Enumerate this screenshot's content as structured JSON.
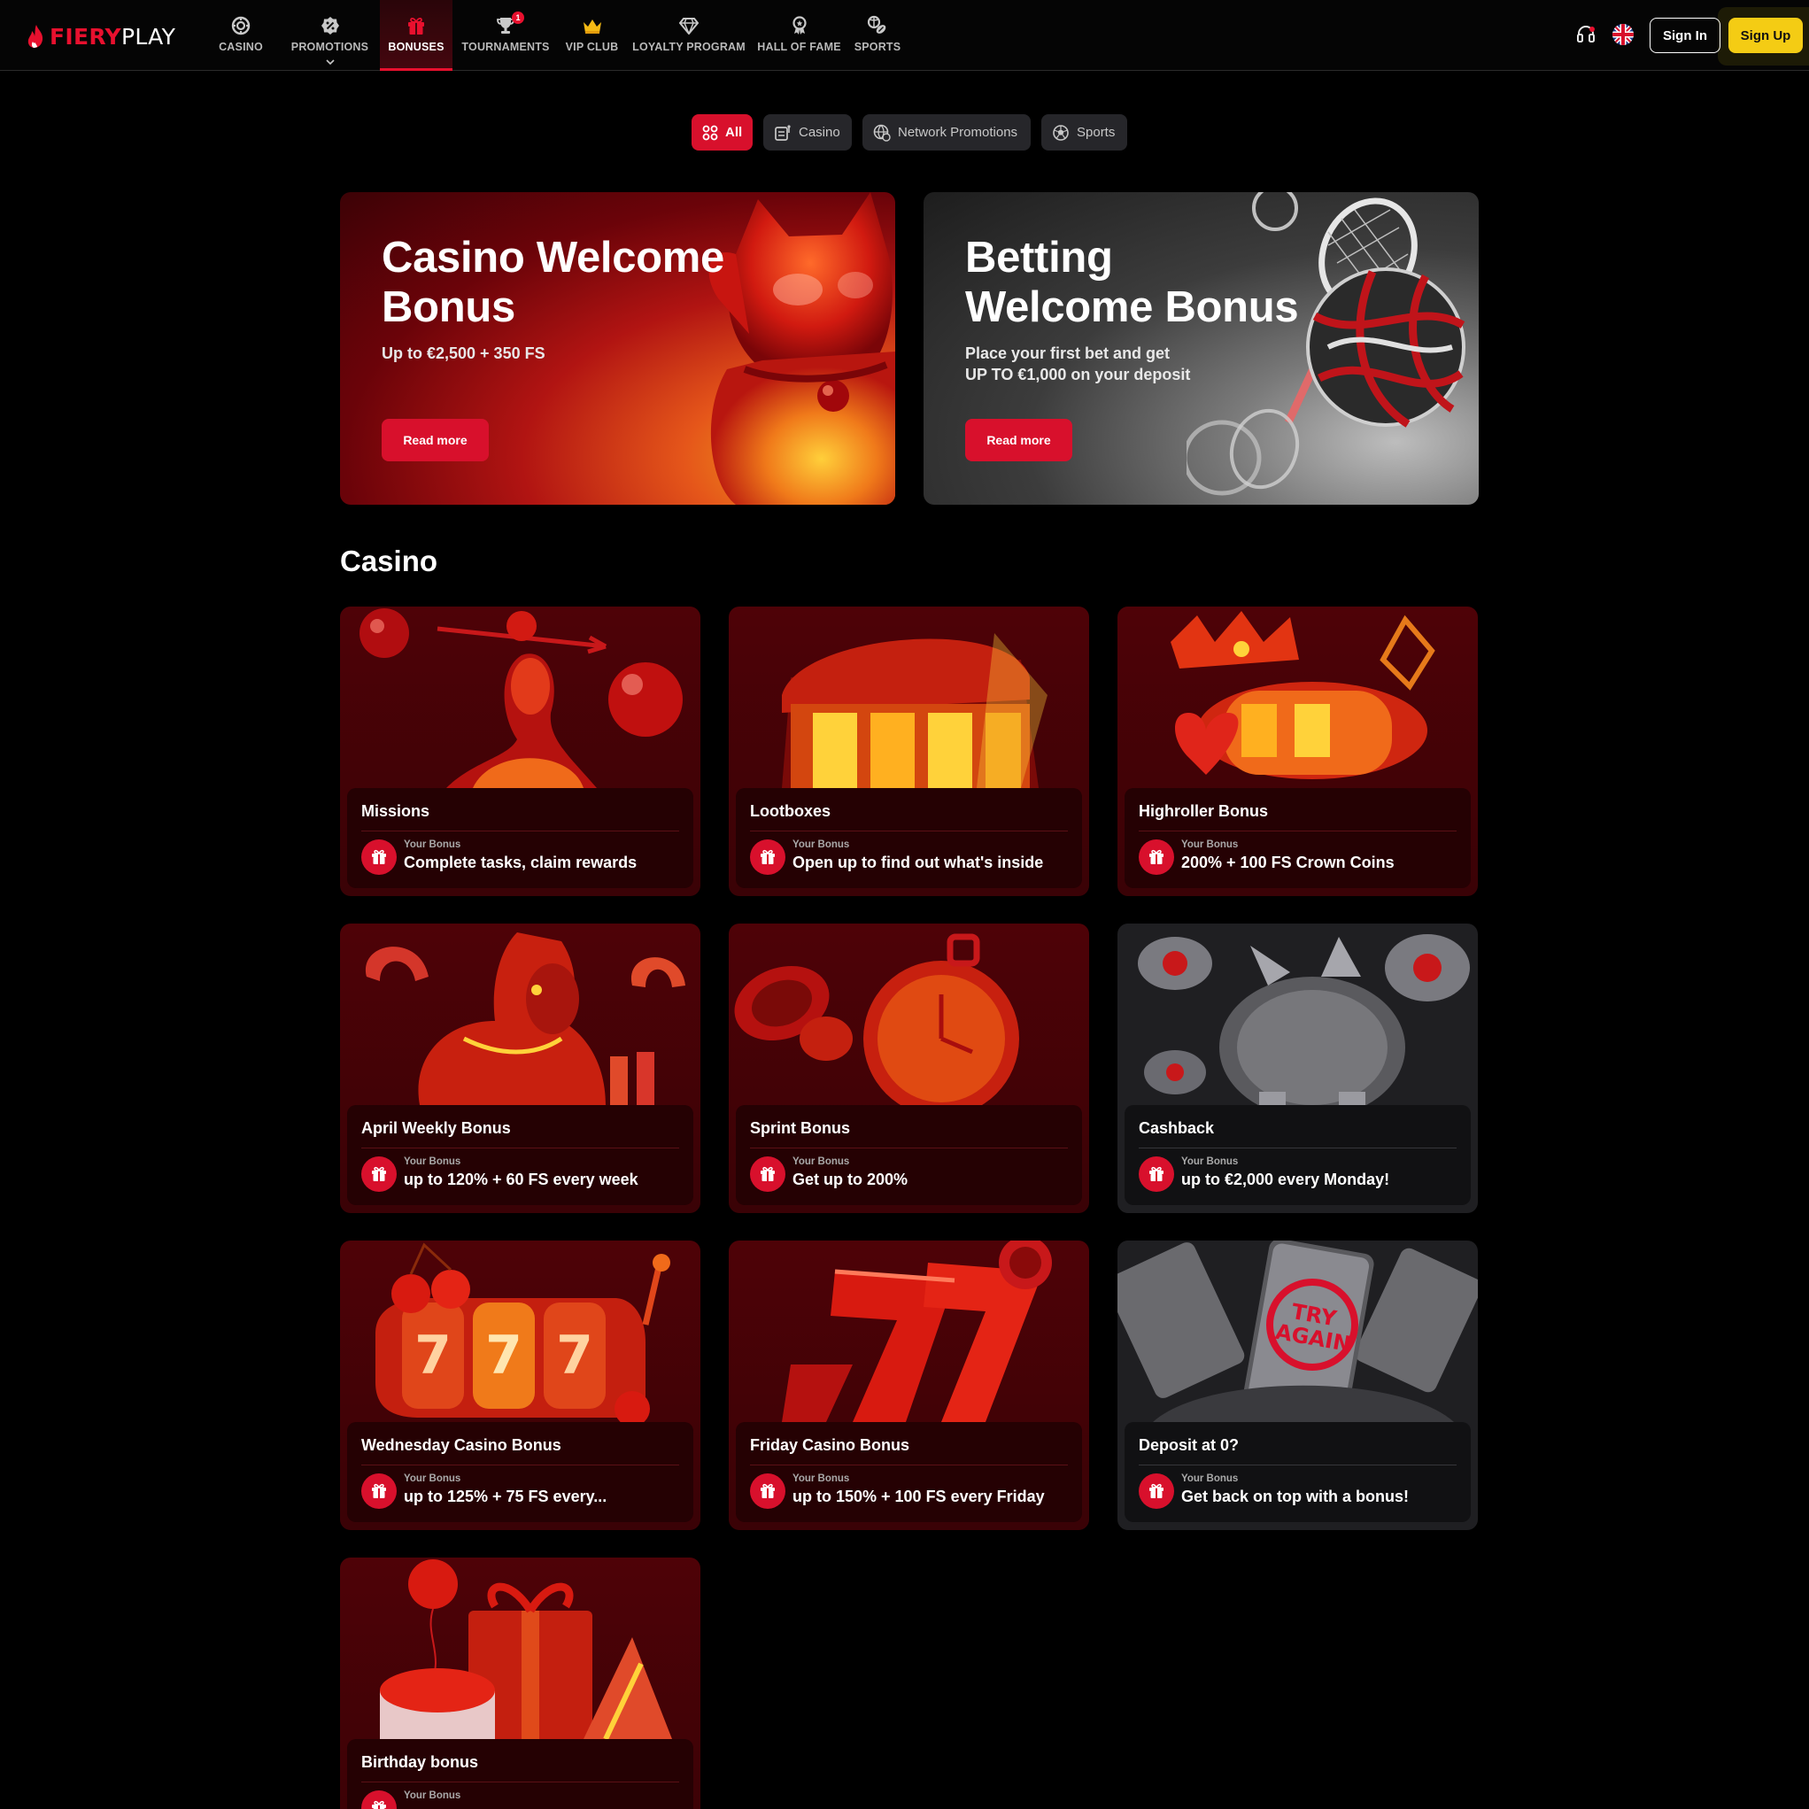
{
  "brand": {
    "name_red": "FIERY",
    "name_white": "PLAY"
  },
  "nav": [
    {
      "label": "CASINO",
      "icon": "casino-chip-icon"
    },
    {
      "label": "PROMOTIONS",
      "icon": "percent-badge-icon"
    },
    {
      "label": "BONUSES",
      "icon": "gift-icon",
      "active": true
    },
    {
      "label": "TOURNAMENTS",
      "icon": "trophy-icon",
      "badge": "1"
    },
    {
      "label": "VIP CLUB",
      "icon": "crown-icon"
    },
    {
      "label": "LOYALTY PROGRAM",
      "icon": "diamond-icon"
    },
    {
      "label": "HALL OF FAME",
      "icon": "medal-icon"
    },
    {
      "label": "SPORTS",
      "icon": "sports-ball-icon"
    }
  ],
  "header": {
    "signin": "Sign In",
    "signup": "Sign Up",
    "support_icon": "headset-icon",
    "language_icon": "uk-flag-icon"
  },
  "filters": [
    {
      "label": "All",
      "icon": "grid-icon",
      "active": true
    },
    {
      "label": "Casino",
      "icon": "slot-icon"
    },
    {
      "label": "Network Promotions",
      "icon": "network-icon"
    },
    {
      "label": "Sports",
      "icon": "sports-ball-icon"
    }
  ],
  "heroes": [
    {
      "title_line1": "Casino Welcome",
      "title_line2": "Bonus",
      "sub_line1": "Up to €2,500 + 350 FS",
      "sub_line2": "",
      "button": "Read more"
    },
    {
      "title_line1": "Betting",
      "title_line2": "Welcome Bonus",
      "sub_line1": "Place your first bet and get",
      "sub_line2": "UP TO €1,000 on your deposit",
      "button": "Read more"
    }
  ],
  "section": {
    "title": "Casino"
  },
  "cards": [
    {
      "title": "Missions",
      "label": "Your Bonus",
      "value": "Complete tasks, claim rewards",
      "theme": "red",
      "art": "missions"
    },
    {
      "title": "Lootboxes",
      "label": "Your Bonus",
      "value": "Open up to find out what's inside",
      "theme": "red",
      "art": "lootbox"
    },
    {
      "title": "Highroller Bonus",
      "label": "Your Bonus",
      "value": "200% + 100 FS Crown Coins",
      "theme": "red",
      "art": "highroller"
    },
    {
      "title": "April Weekly Bonus",
      "label": "Your Bonus",
      "value": "up to 120% + 60 FS every week",
      "theme": "red",
      "art": "horse"
    },
    {
      "title": "Sprint Bonus",
      "label": "Your Bonus",
      "value": "Get up to 200%",
      "theme": "red",
      "art": "stopwatch"
    },
    {
      "title": "Cashback",
      "label": "Your Bonus",
      "value": "up to €2,000 every Monday!",
      "theme": "dark",
      "art": "piggy"
    },
    {
      "title": "Wednesday Casino Bonus",
      "label": "Your Bonus",
      "value": "up to 125% + 75 FS every...",
      "theme": "red",
      "art": "slot777"
    },
    {
      "title": "Friday Casino Bonus",
      "label": "Your Bonus",
      "value": "up to 150% + 100 FS every Friday",
      "theme": "red",
      "art": "sevens"
    },
    {
      "title": "Deposit at 0?",
      "label": "Your Bonus",
      "value": "Get back on top with a bonus!",
      "theme": "dark",
      "art": "tryagain"
    },
    {
      "title": "Birthday bonus",
      "label": "Your Bonus",
      "value": "",
      "theme": "red",
      "art": "birthday"
    }
  ],
  "colors": {
    "accent": "#d8102c",
    "signup": "#f4cc14",
    "background": "#000000",
    "card_red": "#4e0207",
    "card_dark": "#1f1f22"
  }
}
